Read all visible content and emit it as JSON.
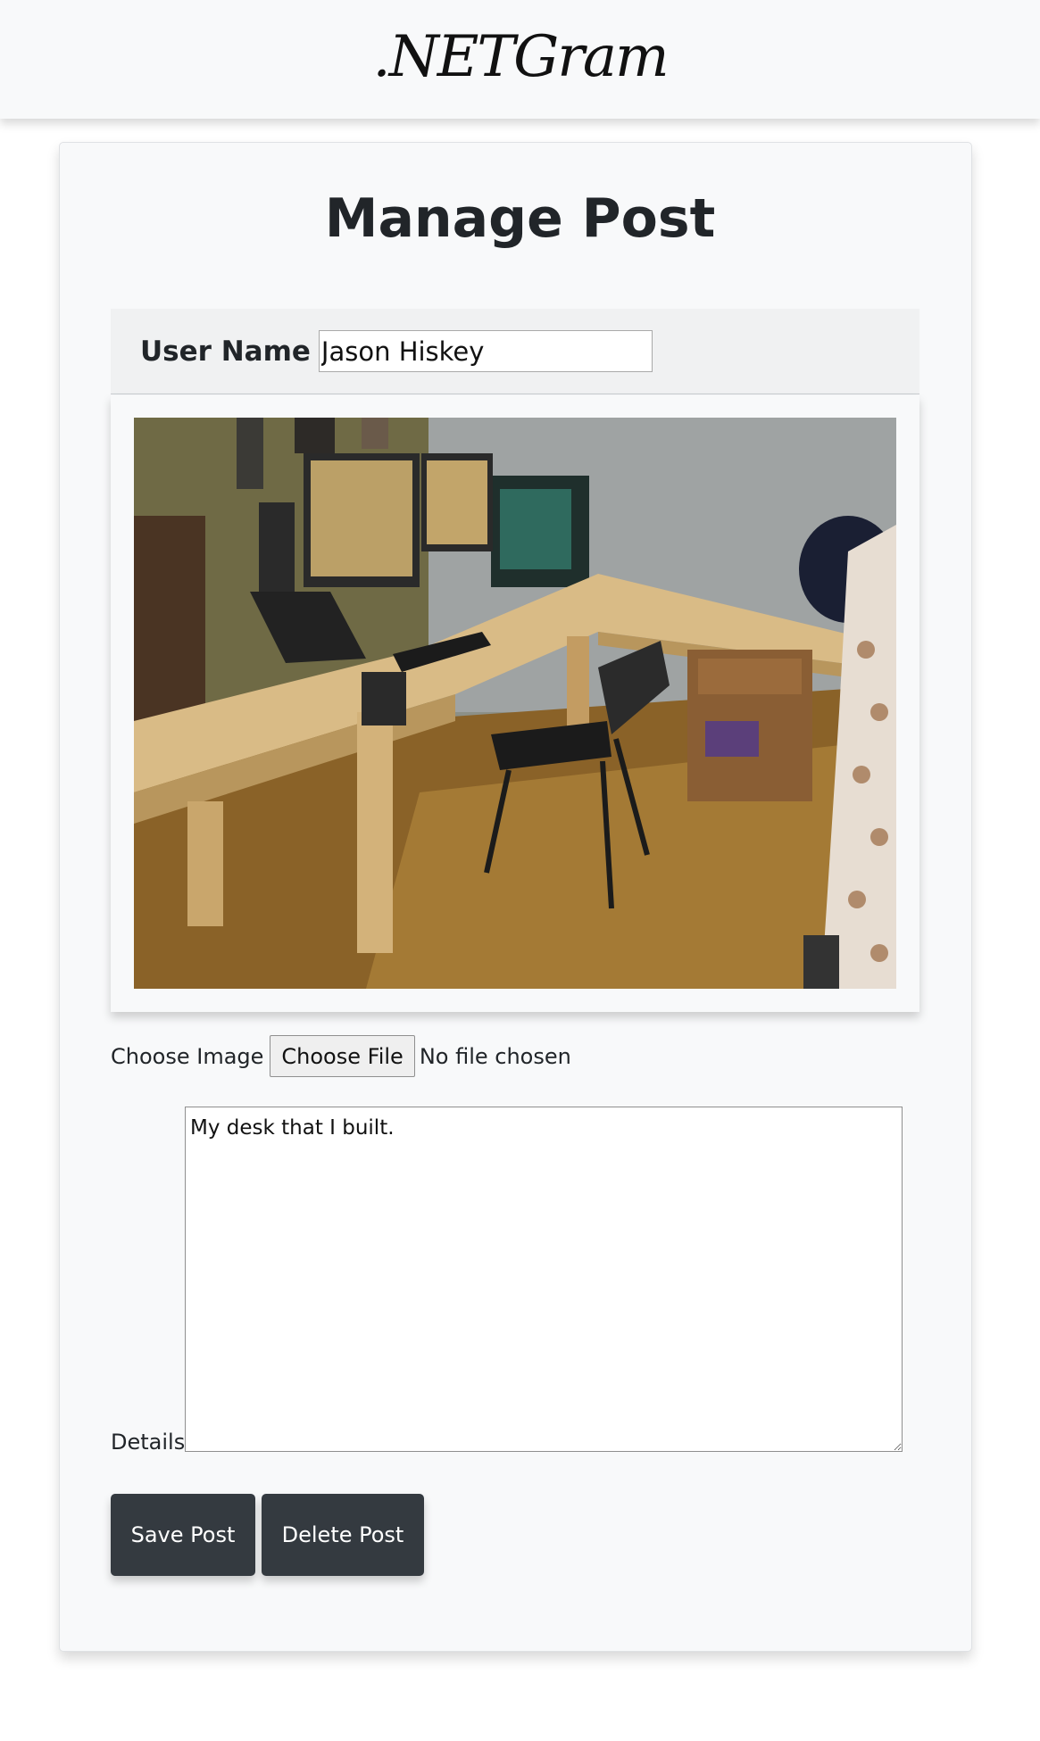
{
  "navbar": {
    "brand": ".NETGram"
  },
  "page": {
    "title": "Manage Post"
  },
  "user": {
    "label": "User Name",
    "value": "Jason Hiskey"
  },
  "image": {
    "alt": "photo of an L-shaped wooden desk with monitors and a chair"
  },
  "file_input": {
    "label": "Choose Image",
    "button": "Choose File",
    "status": "No file chosen"
  },
  "details": {
    "label": "Details",
    "value": "My desk that I built."
  },
  "actions": {
    "save": "Save Post",
    "delete": "Delete Post"
  }
}
